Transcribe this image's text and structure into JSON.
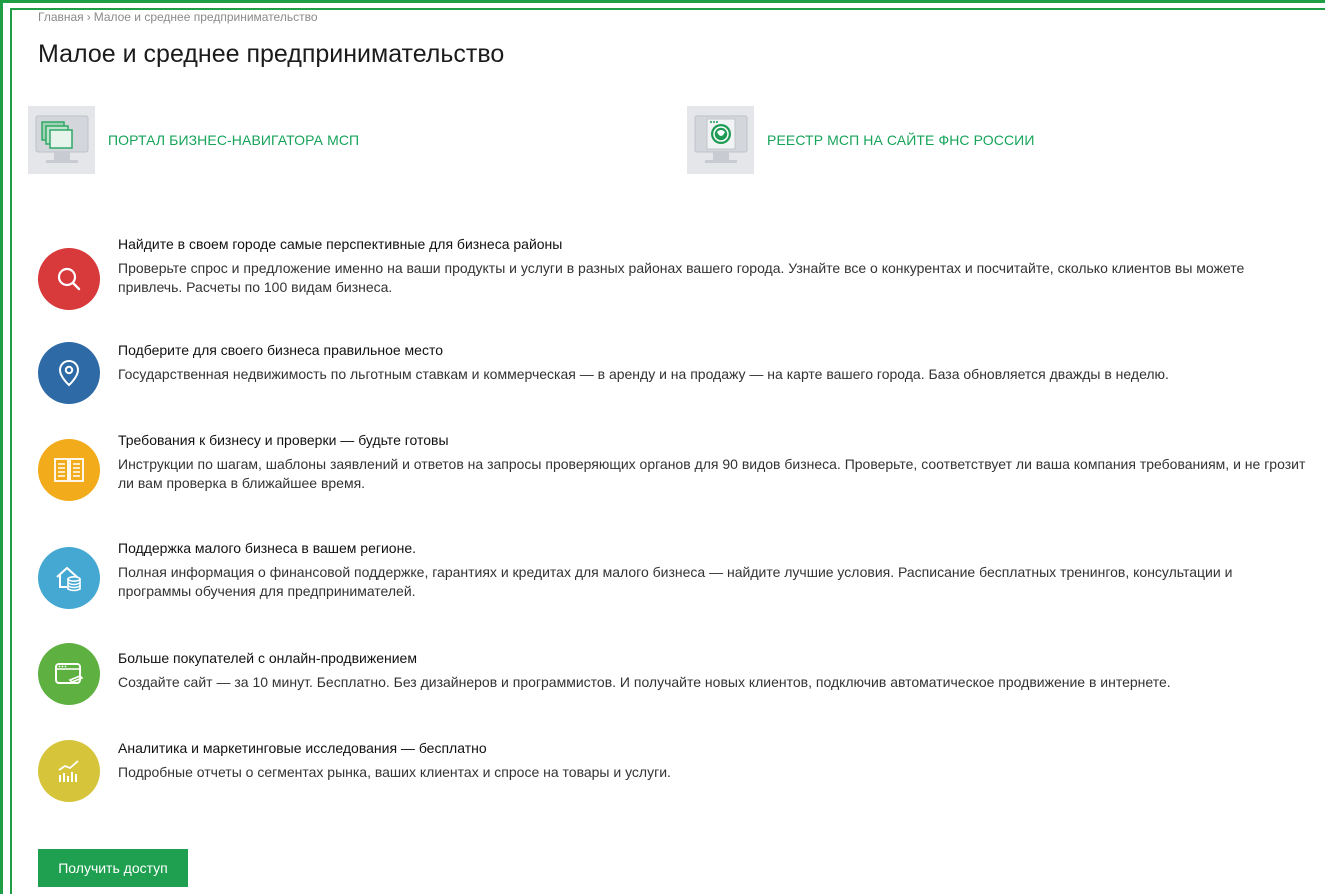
{
  "breadcrumb": {
    "home": "Главная",
    "separator": "›",
    "current": "Малое и среднее предпринимательство"
  },
  "page_title": "Малое и среднее предпринимательство",
  "portals": [
    {
      "label": "ПОРТАЛ БИЗНЕС-НАВИГАТОРА МСП",
      "icon": "navigator-monitor-icon"
    },
    {
      "label": "РЕЕСТР МСП НА САЙТЕ ФНС РОССИИ",
      "icon": "fns-monitor-icon"
    }
  ],
  "features": [
    {
      "title": "Найдите в своем городе самые перспективные для бизнеса районы",
      "text": "Проверьте спрос и предложение именно на ваши продукты и услуги в разных районах вашего города. Узнайте все о конкурентах и посчитайте, сколько клиентов вы можете привлечь. Расчеты по 100 видам бизнеса.",
      "icon": "search-icon",
      "color": "#d8393a"
    },
    {
      "title": "Подберите для своего бизнеса правильное место",
      "text": "Государственная недвижимость по льготным ставкам и коммерческая — в аренду и на продажу — на карте вашего города. База обновляется дважды в неделю.",
      "icon": "map-pin-icon",
      "color": "#2d6aa6"
    },
    {
      "title": "Требования к бизнесу и проверки — будьте готовы",
      "text": "Инструкции по шагам, шаблоны заявлений и ответов на запросы проверяющих органов для 90 видов бизнеса. Проверьте, соответствует ли ваша компания требованиям, и не грозит ли вам проверка в ближайшее время.",
      "icon": "open-book-icon",
      "color": "#f2ab1a"
    },
    {
      "title": "Поддержка малого бизнеса в вашем регионе.",
      "text": "Полная информация о финансовой поддержке, гарантиях и кредитах для малого бизнеса — найдите лучшие условия. Расписание бесплатных тренингов, консультации и программы обучения для предпринимателей.",
      "icon": "house-coins-icon",
      "color": "#45a8d2"
    },
    {
      "title": "Больше покупателей с онлайн-продвижением",
      "text": "Создайте сайт — за 10 минут. Бесплатно. Без дизайнеров и программистов. И получайте новых клиентов, подключив автоматическое продвижение в интернете.",
      "icon": "browser-edit-icon",
      "color": "#5eb140"
    },
    {
      "title": "Аналитика и маркетинговые исследования — бесплатно",
      "text": "Подробные отчеты о сегментах рынка, ваших клиентах и спросе на товары и услуги.",
      "icon": "analytics-chart-icon",
      "color": "#d6c43a"
    }
  ],
  "cta_button": "Получить доступ"
}
